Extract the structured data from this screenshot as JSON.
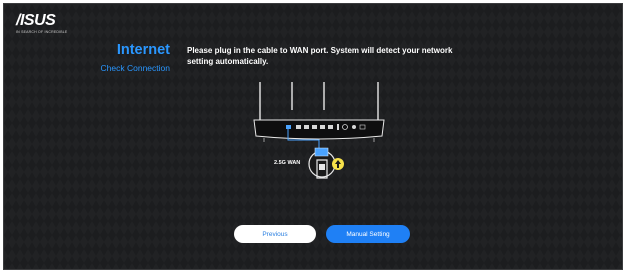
{
  "logo": {
    "wordmark": "/ISUS",
    "tagline": "IN SEARCH OF INCREDIBLE"
  },
  "section": {
    "title": "Internet",
    "subtitle": "Check Connection"
  },
  "message": "Please plug in the cable to WAN port. System will detect your network setting automatically.",
  "illustration": {
    "port_label": "2.5G WAN"
  },
  "buttons": {
    "previous": "Previous",
    "manual": "Manual Setting"
  },
  "colors": {
    "accent": "#2a97ff",
    "button_primary": "#1f80f5",
    "background": "#1c1d1f"
  }
}
